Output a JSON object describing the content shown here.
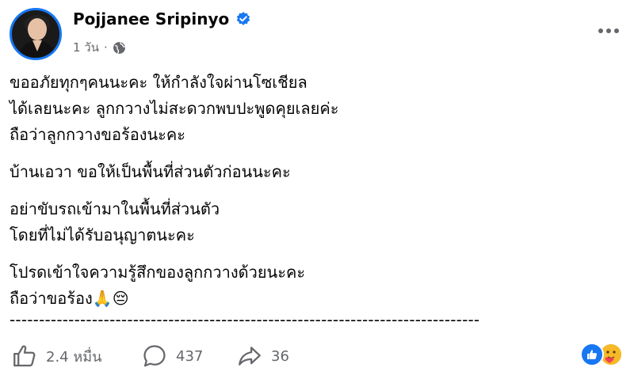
{
  "post": {
    "author": "Pojjanee Sripinyo",
    "time": "1 วัน",
    "separator": "·",
    "paragraphs": [
      [
        "ขออภัยทุกๆคนนะคะ ให้กำลังใจผ่านโซเชียล",
        "ได้เลยนะคะ ลูกกวางไม่สะดวกพบปะพูดคุยเลยค่ะ",
        "ถือว่าลูกกวางขอร้องนะคะ"
      ],
      [
        "บ้านเอวา ขอให้เป็นพื้นที่ส่วนตัวก่อนนะคะ"
      ],
      [
        "อย่าขับรถเข้ามาในพื้นที่ส่วนตัว",
        "โดยที่ไม่ได้รับอนุญาตนะคะ"
      ],
      [
        "โปรดเข้าใจความรู้สึกของลูกกวางด้วยนะคะ",
        "ถือว่าขอร้อง🙏😔"
      ]
    ],
    "divider": "--------------------------------------------------------------------------------"
  },
  "actions": {
    "likes": "2.4 หมื่น",
    "comments": "437",
    "shares": "36"
  },
  "icons": {
    "verified": "verified-badge-icon",
    "privacy": "globe-icon",
    "more": "more-options-icon",
    "like": "thumbs-up-icon",
    "comment": "comment-bubble-icon",
    "share": "share-arrow-icon",
    "reaction_like": "like-reaction-icon",
    "reaction_care": "care-reaction-icon"
  },
  "colors": {
    "accent": "#1877f2",
    "secondary_text": "#65676b"
  }
}
